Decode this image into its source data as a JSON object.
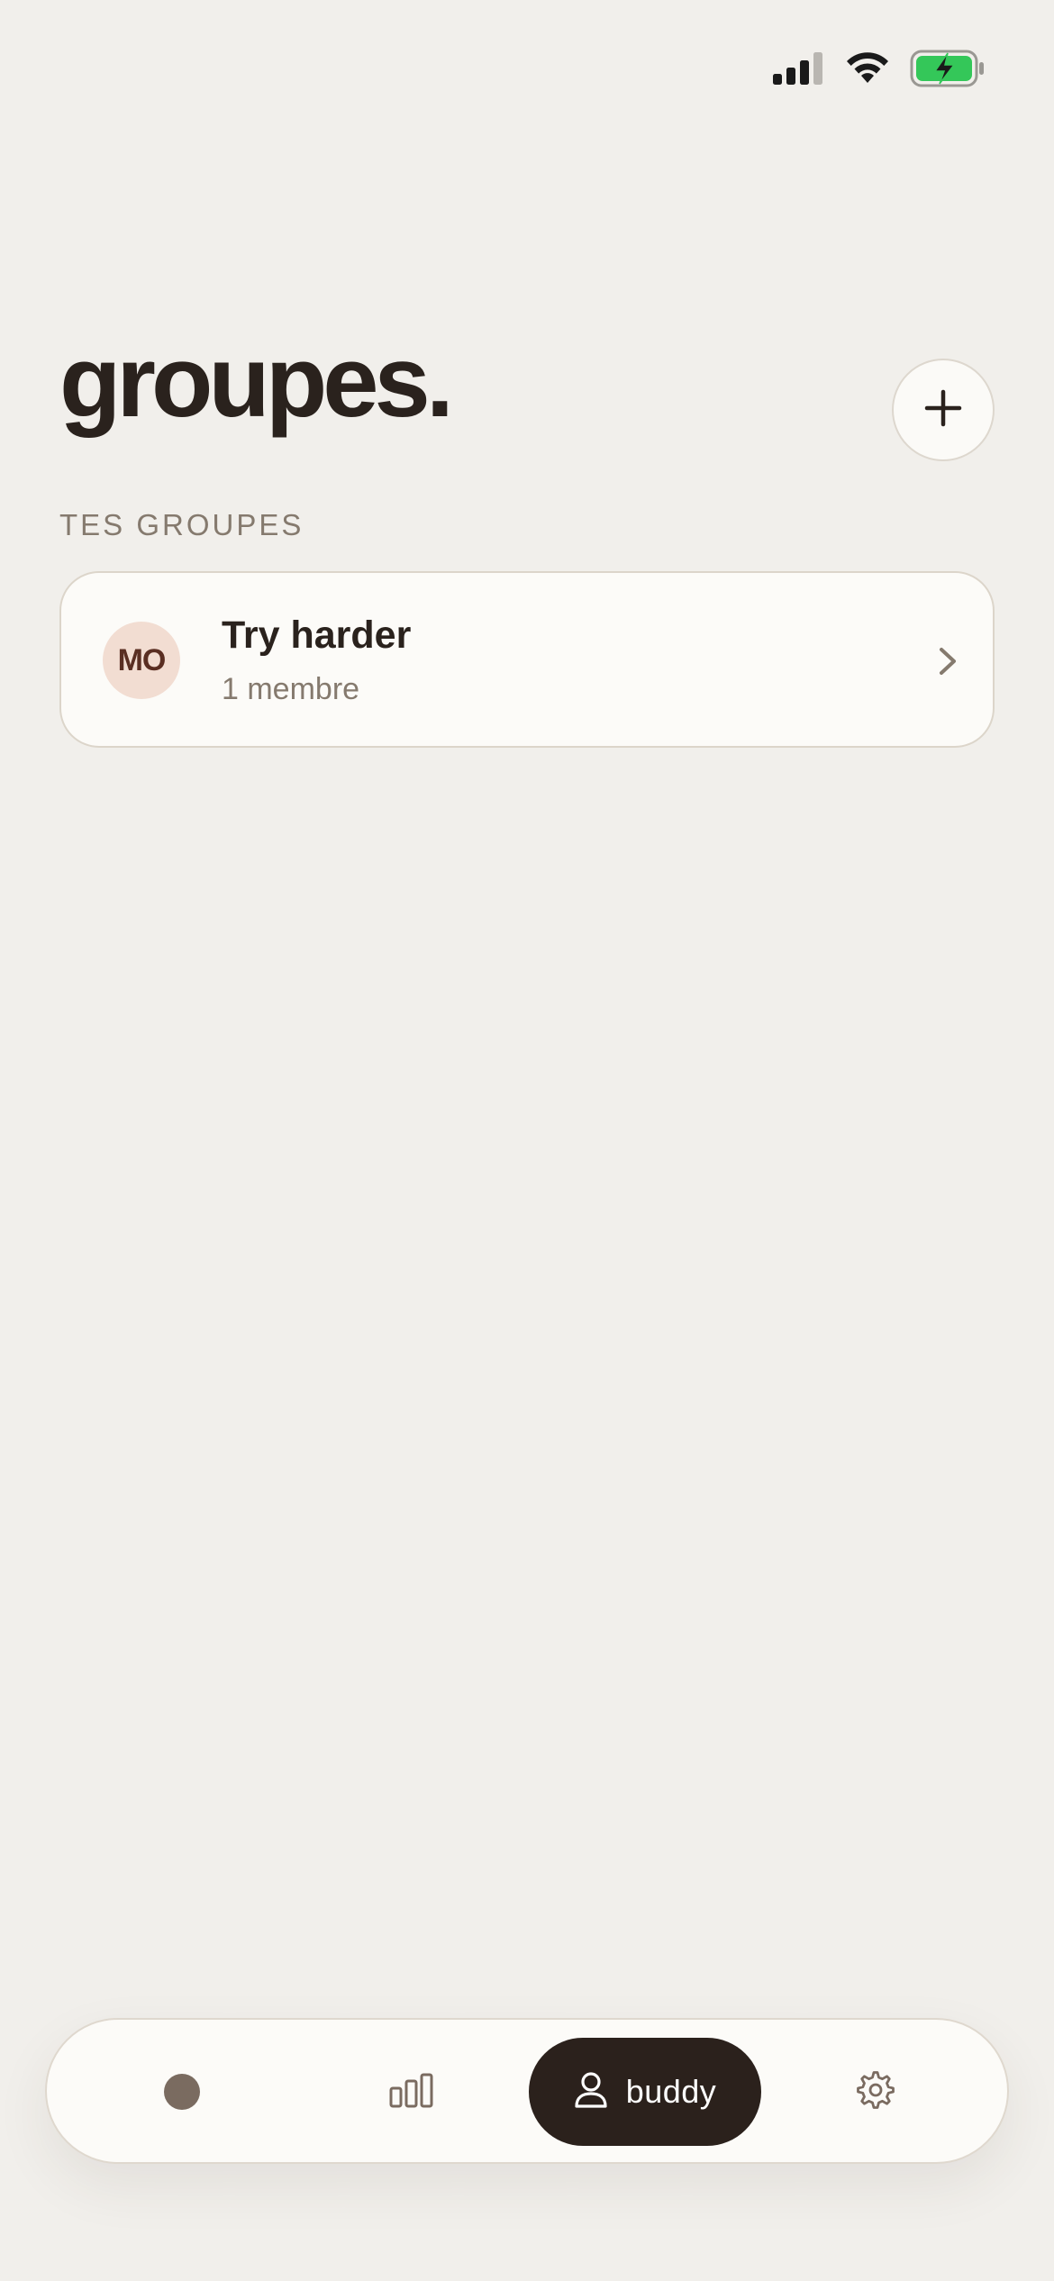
{
  "header": {
    "title": "groupes.",
    "section_label": "TES GROUPES"
  },
  "groups": [
    {
      "initials": "MO",
      "name": "Try harder",
      "members": "1 membre"
    }
  ],
  "nav": {
    "active": "buddy",
    "buddy_label": "buddy",
    "items": [
      "today-icon",
      "stats-icon",
      "buddy-icon",
      "settings-icon"
    ]
  },
  "colors": {
    "background": "#F1EFEB",
    "text": "#2A221D",
    "muted": "#857A6E",
    "accent_dark": "#2B211C",
    "avatar_bg": "#F2DDD2",
    "battery": "#34C759"
  },
  "status_bar": {
    "icons": [
      "cellular-signal-icon",
      "wifi-icon",
      "battery-charging-icon"
    ]
  }
}
